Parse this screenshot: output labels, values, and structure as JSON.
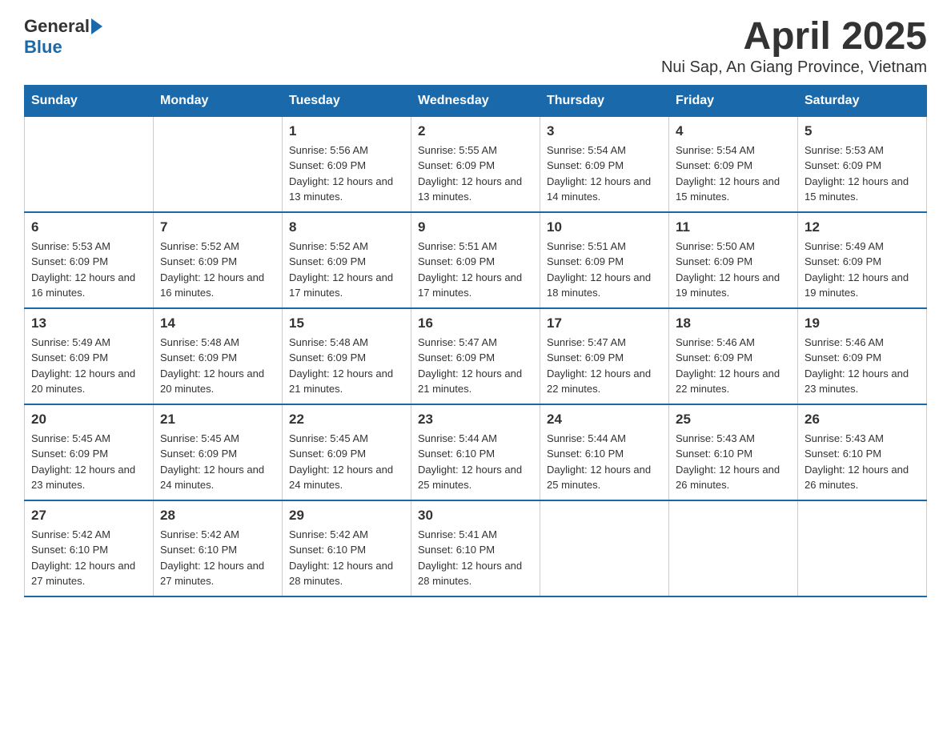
{
  "header": {
    "logo_general": "General",
    "logo_blue": "Blue",
    "title": "April 2025",
    "subtitle": "Nui Sap, An Giang Province, Vietnam"
  },
  "days_of_week": [
    "Sunday",
    "Monday",
    "Tuesday",
    "Wednesday",
    "Thursday",
    "Friday",
    "Saturday"
  ],
  "weeks": [
    [
      {
        "day": "",
        "sunrise": "",
        "sunset": "",
        "daylight": ""
      },
      {
        "day": "",
        "sunrise": "",
        "sunset": "",
        "daylight": ""
      },
      {
        "day": "1",
        "sunrise": "Sunrise: 5:56 AM",
        "sunset": "Sunset: 6:09 PM",
        "daylight": "Daylight: 12 hours and 13 minutes."
      },
      {
        "day": "2",
        "sunrise": "Sunrise: 5:55 AM",
        "sunset": "Sunset: 6:09 PM",
        "daylight": "Daylight: 12 hours and 13 minutes."
      },
      {
        "day": "3",
        "sunrise": "Sunrise: 5:54 AM",
        "sunset": "Sunset: 6:09 PM",
        "daylight": "Daylight: 12 hours and 14 minutes."
      },
      {
        "day": "4",
        "sunrise": "Sunrise: 5:54 AM",
        "sunset": "Sunset: 6:09 PM",
        "daylight": "Daylight: 12 hours and 15 minutes."
      },
      {
        "day": "5",
        "sunrise": "Sunrise: 5:53 AM",
        "sunset": "Sunset: 6:09 PM",
        "daylight": "Daylight: 12 hours and 15 minutes."
      }
    ],
    [
      {
        "day": "6",
        "sunrise": "Sunrise: 5:53 AM",
        "sunset": "Sunset: 6:09 PM",
        "daylight": "Daylight: 12 hours and 16 minutes."
      },
      {
        "day": "7",
        "sunrise": "Sunrise: 5:52 AM",
        "sunset": "Sunset: 6:09 PM",
        "daylight": "Daylight: 12 hours and 16 minutes."
      },
      {
        "day": "8",
        "sunrise": "Sunrise: 5:52 AM",
        "sunset": "Sunset: 6:09 PM",
        "daylight": "Daylight: 12 hours and 17 minutes."
      },
      {
        "day": "9",
        "sunrise": "Sunrise: 5:51 AM",
        "sunset": "Sunset: 6:09 PM",
        "daylight": "Daylight: 12 hours and 17 minutes."
      },
      {
        "day": "10",
        "sunrise": "Sunrise: 5:51 AM",
        "sunset": "Sunset: 6:09 PM",
        "daylight": "Daylight: 12 hours and 18 minutes."
      },
      {
        "day": "11",
        "sunrise": "Sunrise: 5:50 AM",
        "sunset": "Sunset: 6:09 PM",
        "daylight": "Daylight: 12 hours and 19 minutes."
      },
      {
        "day": "12",
        "sunrise": "Sunrise: 5:49 AM",
        "sunset": "Sunset: 6:09 PM",
        "daylight": "Daylight: 12 hours and 19 minutes."
      }
    ],
    [
      {
        "day": "13",
        "sunrise": "Sunrise: 5:49 AM",
        "sunset": "Sunset: 6:09 PM",
        "daylight": "Daylight: 12 hours and 20 minutes."
      },
      {
        "day": "14",
        "sunrise": "Sunrise: 5:48 AM",
        "sunset": "Sunset: 6:09 PM",
        "daylight": "Daylight: 12 hours and 20 minutes."
      },
      {
        "day": "15",
        "sunrise": "Sunrise: 5:48 AM",
        "sunset": "Sunset: 6:09 PM",
        "daylight": "Daylight: 12 hours and 21 minutes."
      },
      {
        "day": "16",
        "sunrise": "Sunrise: 5:47 AM",
        "sunset": "Sunset: 6:09 PM",
        "daylight": "Daylight: 12 hours and 21 minutes."
      },
      {
        "day": "17",
        "sunrise": "Sunrise: 5:47 AM",
        "sunset": "Sunset: 6:09 PM",
        "daylight": "Daylight: 12 hours and 22 minutes."
      },
      {
        "day": "18",
        "sunrise": "Sunrise: 5:46 AM",
        "sunset": "Sunset: 6:09 PM",
        "daylight": "Daylight: 12 hours and 22 minutes."
      },
      {
        "day": "19",
        "sunrise": "Sunrise: 5:46 AM",
        "sunset": "Sunset: 6:09 PM",
        "daylight": "Daylight: 12 hours and 23 minutes."
      }
    ],
    [
      {
        "day": "20",
        "sunrise": "Sunrise: 5:45 AM",
        "sunset": "Sunset: 6:09 PM",
        "daylight": "Daylight: 12 hours and 23 minutes."
      },
      {
        "day": "21",
        "sunrise": "Sunrise: 5:45 AM",
        "sunset": "Sunset: 6:09 PM",
        "daylight": "Daylight: 12 hours and 24 minutes."
      },
      {
        "day": "22",
        "sunrise": "Sunrise: 5:45 AM",
        "sunset": "Sunset: 6:09 PM",
        "daylight": "Daylight: 12 hours and 24 minutes."
      },
      {
        "day": "23",
        "sunrise": "Sunrise: 5:44 AM",
        "sunset": "Sunset: 6:10 PM",
        "daylight": "Daylight: 12 hours and 25 minutes."
      },
      {
        "day": "24",
        "sunrise": "Sunrise: 5:44 AM",
        "sunset": "Sunset: 6:10 PM",
        "daylight": "Daylight: 12 hours and 25 minutes."
      },
      {
        "day": "25",
        "sunrise": "Sunrise: 5:43 AM",
        "sunset": "Sunset: 6:10 PM",
        "daylight": "Daylight: 12 hours and 26 minutes."
      },
      {
        "day": "26",
        "sunrise": "Sunrise: 5:43 AM",
        "sunset": "Sunset: 6:10 PM",
        "daylight": "Daylight: 12 hours and 26 minutes."
      }
    ],
    [
      {
        "day": "27",
        "sunrise": "Sunrise: 5:42 AM",
        "sunset": "Sunset: 6:10 PM",
        "daylight": "Daylight: 12 hours and 27 minutes."
      },
      {
        "day": "28",
        "sunrise": "Sunrise: 5:42 AM",
        "sunset": "Sunset: 6:10 PM",
        "daylight": "Daylight: 12 hours and 27 minutes."
      },
      {
        "day": "29",
        "sunrise": "Sunrise: 5:42 AM",
        "sunset": "Sunset: 6:10 PM",
        "daylight": "Daylight: 12 hours and 28 minutes."
      },
      {
        "day": "30",
        "sunrise": "Sunrise: 5:41 AM",
        "sunset": "Sunset: 6:10 PM",
        "daylight": "Daylight: 12 hours and 28 minutes."
      },
      {
        "day": "",
        "sunrise": "",
        "sunset": "",
        "daylight": ""
      },
      {
        "day": "",
        "sunrise": "",
        "sunset": "",
        "daylight": ""
      },
      {
        "day": "",
        "sunrise": "",
        "sunset": "",
        "daylight": ""
      }
    ]
  ]
}
